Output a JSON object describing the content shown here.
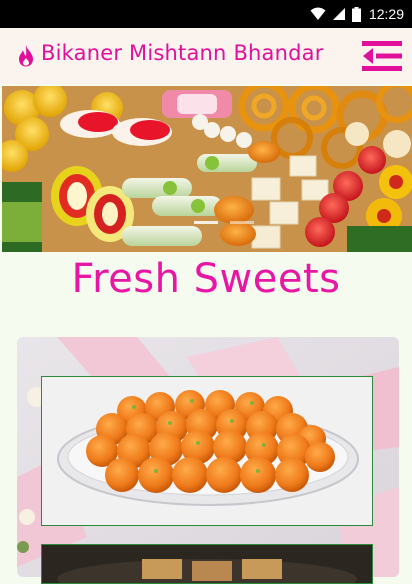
{
  "status_bar": {
    "time": "12:29",
    "icons": [
      "wifi-icon",
      "signal-icon",
      "battery-icon"
    ]
  },
  "header": {
    "title": "Bikaner Mishtann Bhandar",
    "brand_icon": "flame-icon",
    "menu_icon": "menu-collapse-icon",
    "background": "#fbf3ee",
    "accent": "#e0109a"
  },
  "hero": {
    "content": "assorted Indian sweets banner photo",
    "carousel_dots": 2
  },
  "main": {
    "section_title": "Fresh Sweets",
    "title_color": "#e816a4",
    "page_background": "#f6fbf0",
    "products": [
      {
        "content": "plate of motichoor laddoos photo"
      },
      {
        "content": "plate of sweets photo"
      }
    ]
  }
}
